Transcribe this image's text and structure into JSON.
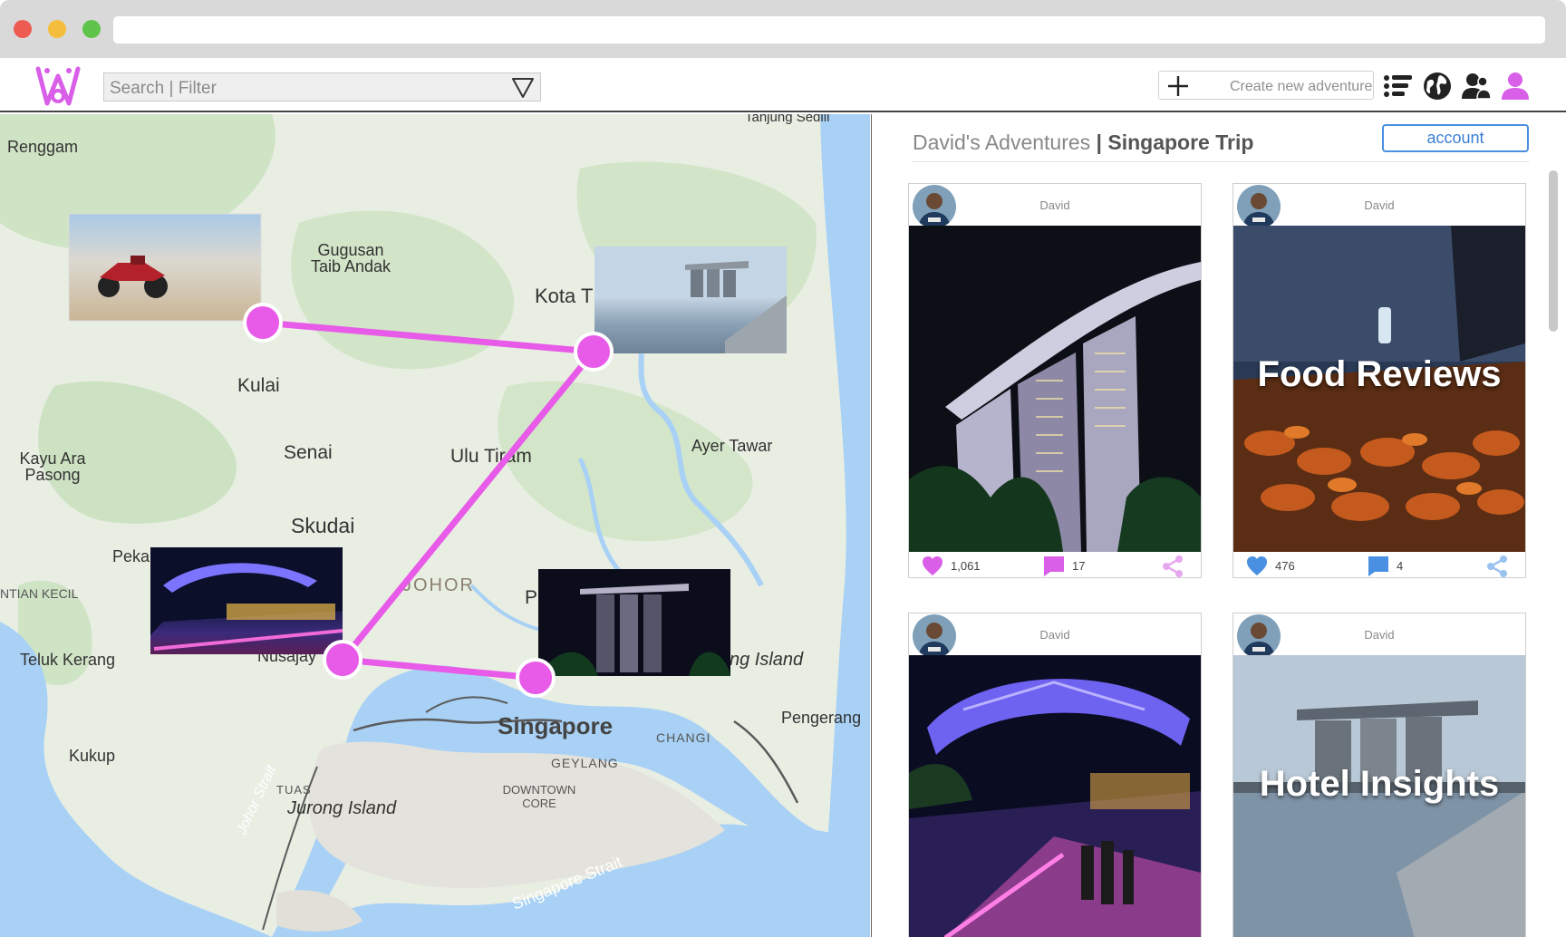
{
  "window": {
    "colors": {
      "close": "#ee5b51",
      "minimize": "#f5bd3c",
      "maximize": "#5fc54a"
    }
  },
  "app": {
    "brand_color": "#d95ee8",
    "search": {
      "placeholder": "Search | Filter"
    },
    "create_button": "Create new adventure",
    "nav_icons": [
      "list-icon",
      "globe-icon",
      "friends-icon",
      "profile-icon"
    ]
  },
  "map": {
    "route_color": "#e85ae8",
    "labels": {
      "renggam": "Renggam",
      "gugusan": "Gugusan\nTaib Andak",
      "kota": "Kota T",
      "kulai": "Kulai",
      "senai": "Senai",
      "ulu_tiram": "Ulu Tiram",
      "ayer_tawar": "Ayer Tawar",
      "kayu_ara": "Kayu Ara\nPasong",
      "skudai": "Skudai",
      "peka": "Peka",
      "ntian_kecil": "NTIAN KECIL",
      "johor": "JOHOR",
      "p": "P",
      "teluk_kerang": "Teluk Kerang",
      "nusajay": "Nusajay",
      "ng_island": "ng Island",
      "pengerang": "Pengerang",
      "singapore": "Singapore",
      "changi": "CHANGI",
      "geylang": "GEYLANG",
      "kukup": "Kukup",
      "johor_strait": "Johor Strait",
      "tuas": "TUAS",
      "jurong_island": "Jurong Island",
      "downtown": "DOWNTOWN\nCORE",
      "singapore_strait": "Singapore Strait",
      "tanjung": "Tanjung Sedili"
    }
  },
  "page": {
    "owner": "David's Adventures",
    "separator": " | ",
    "trip": "Singapore Trip",
    "account_button": "account"
  },
  "cards": [
    {
      "user": "David",
      "likes": "1,061",
      "comments": "17",
      "overlay": "",
      "like_color": "#d95ee8",
      "comment_color": "#d95ee8",
      "share_color": "#e6a8ee"
    },
    {
      "user": "David",
      "likes": "476",
      "comments": "4",
      "overlay": "Food Reviews",
      "like_color": "#4a90e2",
      "comment_color": "#4a90e2",
      "share_color": "#9bc2ee"
    },
    {
      "user": "David",
      "likes": "",
      "comments": "",
      "overlay": "",
      "like_color": "#d95ee8",
      "comment_color": "#d95ee8",
      "share_color": "#e6a8ee"
    },
    {
      "user": "David",
      "likes": "",
      "comments": "",
      "overlay": "Hotel Insights",
      "like_color": "#4a90e2",
      "comment_color": "#4a90e2",
      "share_color": "#9bc2ee"
    }
  ]
}
